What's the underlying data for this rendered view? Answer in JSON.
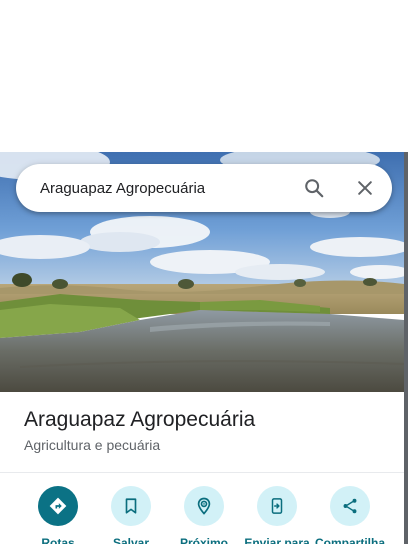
{
  "search": {
    "value": "Araguapaz Agropecuária",
    "placeholder": ""
  },
  "place": {
    "name": "Araguapaz Agropecuária",
    "category": "Agricultura e pecuária"
  },
  "actions": [
    {
      "label": "Rotas",
      "icon": "directions-icon"
    },
    {
      "label": "Salvar",
      "icon": "bookmark-icon"
    },
    {
      "label": "Próximo",
      "icon": "nearby-icon"
    },
    {
      "label": "Enviar para",
      "icon": "send-to-phone-icon"
    },
    {
      "label": "Compartilha",
      "icon": "share-icon"
    }
  ],
  "colors": {
    "primary_action_bg": "#0b7285",
    "secondary_action_bg": "#d2f1f7",
    "action_label": "#0b6e7e",
    "title_text": "#202124",
    "secondary_text": "#5f6368"
  }
}
